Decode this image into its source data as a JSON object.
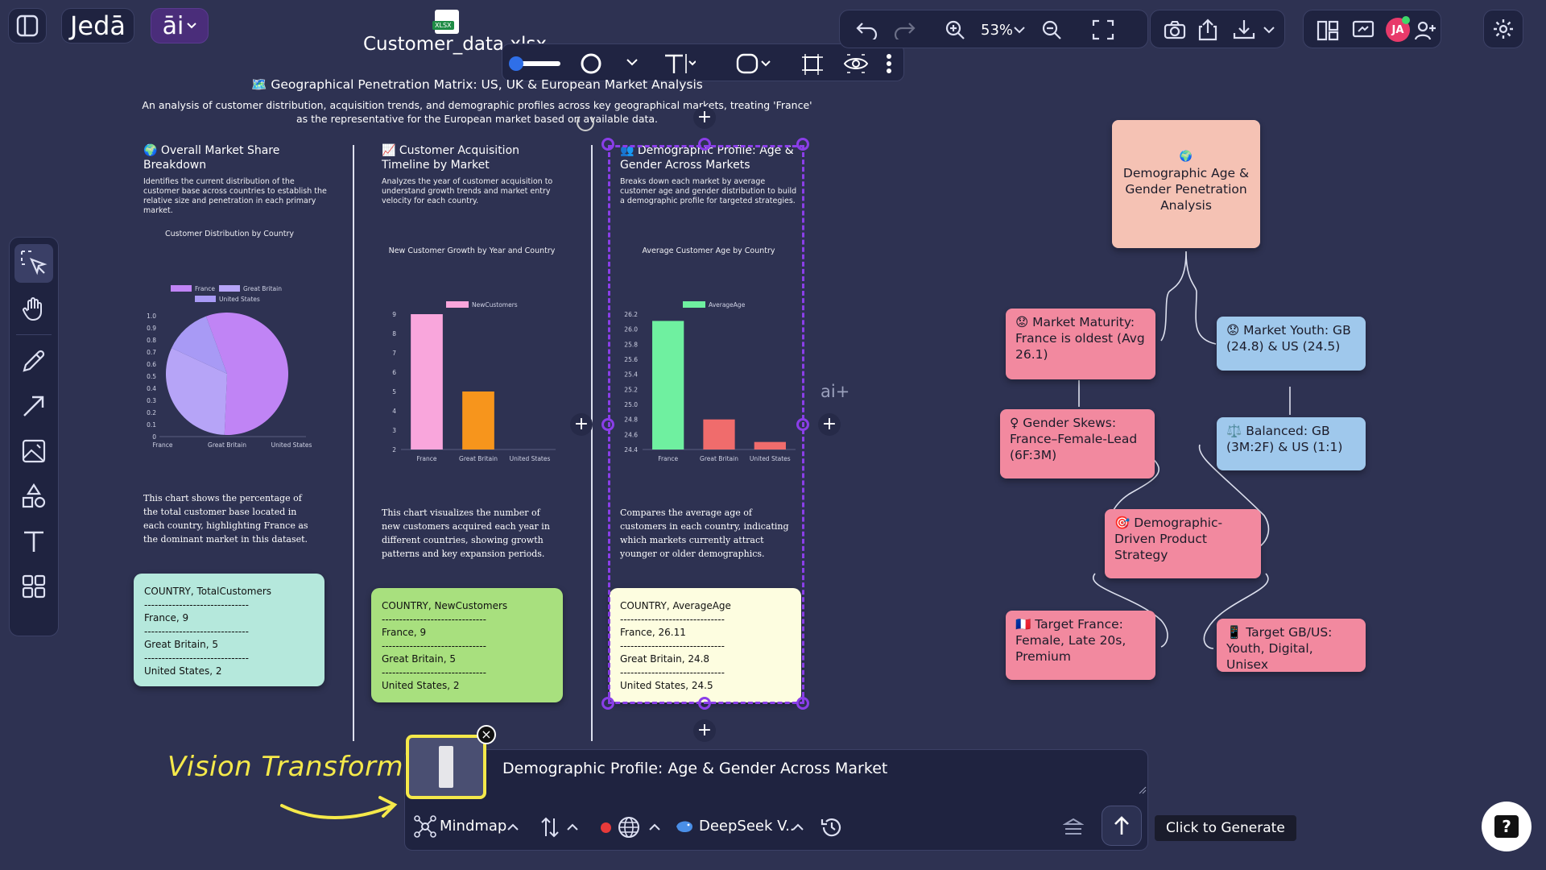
{
  "app": {
    "brand": "Jedā",
    "ai_label": "āi",
    "file_badge": "XLSX",
    "file_name": "Customer_data.xlsx"
  },
  "toolbar_right": {
    "zoom": "53%",
    "avatar_initials": "JA"
  },
  "board": {
    "title": "🗺️ Geographical Penetration Matrix: US, UK & European Market Analysis",
    "subtitle": "An analysis of customer distribution, acquisition trends, and demographic profiles across key geographical markets, treating 'France' as the representative for the European market based on available data."
  },
  "panels": [
    {
      "title": "🌍 Overall Market Share Breakdown",
      "desc": "Identifies the current distribution of the customer base across countries to establish the relative size and penetration in each primary market.",
      "chart_title": "Customer Distribution by Country",
      "summary": "This chart shows the percentage of the total customer base located in each country, highlighting France as the dominant market in this dataset.",
      "note_lines": [
        "COUNTRY, TotalCustomers",
        "------------------------------",
        "France, 9",
        "------------------------------",
        "Great Britain, 5",
        "------------------------------",
        "United States, 2"
      ]
    },
    {
      "title": "📈 Customer Acquisition Timeline by Market",
      "desc": "Analyzes the year of customer acquisition to understand growth trends and market entry velocity for each country.",
      "chart_title": "New Customer Growth by Year and Country",
      "summary": "This chart visualizes the number of new customers acquired each year in different countries, showing growth patterns and key expansion periods.",
      "note_lines": [
        "COUNTRY, NewCustomers",
        "------------------------------",
        "France, 9",
        "------------------------------",
        "Great Britain, 5",
        "------------------------------",
        "United States, 2"
      ]
    },
    {
      "title": "👥 Demographic Profile: Age & Gender Across Markets",
      "desc": "Breaks down each market by average customer age and gender distribution to build a demographic profile for targeted strategies.",
      "chart_title": "Average Customer Age by Country",
      "summary": "Compares the average age of customers in each country, indicating which markets currently attract younger or older demographics.",
      "note_lines": [
        "COUNTRY, AverageAge",
        "------------------------------",
        "France, 26.11",
        "------------------------------",
        "Great Britain, 24.8",
        "------------------------------",
        "United States, 24.5"
      ]
    }
  ],
  "chart_data": [
    {
      "type": "pie",
      "title": "Customer Distribution by Country",
      "categories": [
        "France",
        "Great Britain",
        "United States"
      ],
      "legend": [
        "France",
        "Great Britain",
        "United States"
      ],
      "values": [
        9,
        5,
        2
      ],
      "axis_ticks_y": [
        "1.0",
        "0.9",
        "0.8",
        "0.7",
        "0.6",
        "0.5",
        "0.4",
        "0.3",
        "0.2",
        "0.1",
        "0"
      ],
      "colors": [
        "#c084f5",
        "#b6a4f7",
        "#a89af5"
      ]
    },
    {
      "type": "bar",
      "title": "New Customer Growth by Year and Country",
      "categories": [
        "France",
        "Great Britain",
        "United States"
      ],
      "series": [
        {
          "name": "NewCustomers",
          "values": [
            9,
            5,
            2
          ]
        }
      ],
      "ylim": [
        2,
        9
      ],
      "yticks": [
        2,
        3,
        4,
        5,
        6,
        7,
        8,
        9
      ],
      "colors": [
        "#f9a6dc",
        "#f7951c",
        "#f7951c"
      ]
    },
    {
      "type": "bar",
      "title": "Average Customer Age by Country",
      "categories": [
        "France",
        "Great Britain",
        "United States"
      ],
      "series": [
        {
          "name": "AverageAge",
          "values": [
            26.11,
            24.8,
            24.5
          ]
        }
      ],
      "ylim": [
        24.4,
        26.2
      ],
      "yticks": [
        24.4,
        24.6,
        24.8,
        25.0,
        25.2,
        25.4,
        25.6,
        25.8,
        26.0,
        26.2
      ],
      "colors": [
        "#6ff0a0",
        "#f06c6c",
        "#f06c6c"
      ]
    }
  ],
  "mindmap": {
    "root_icon": "🌍",
    "root": "Demographic Age & Gender Penetration Analysis",
    "n1": "😟 Market Maturity: France is oldest (Avg 26.1)",
    "n2": "😟 Market Youth: GB (24.8) & US (24.5)",
    "n3": "♀ Gender Skews: France–Female-Lead (6F:3M)",
    "n4": "⚖️ Balanced: GB (3M:2F) & US (1:1)",
    "n5": "🎯 Demographic-Driven Product Strategy",
    "n6": "🇫🇷 Target France: Female, Late 20s, Premium",
    "n7": "📱 Target GB/US: Youth, Digital, Unisex"
  },
  "ai_badge": "ai+",
  "vision_label": "Vision Transform",
  "prompt": {
    "text": "Demographic Profile: Age & Gender Across Market",
    "mode": "Mindmap",
    "model": "DeepSeek V..",
    "generate_hint": "Click to Generate"
  },
  "help": "?"
}
